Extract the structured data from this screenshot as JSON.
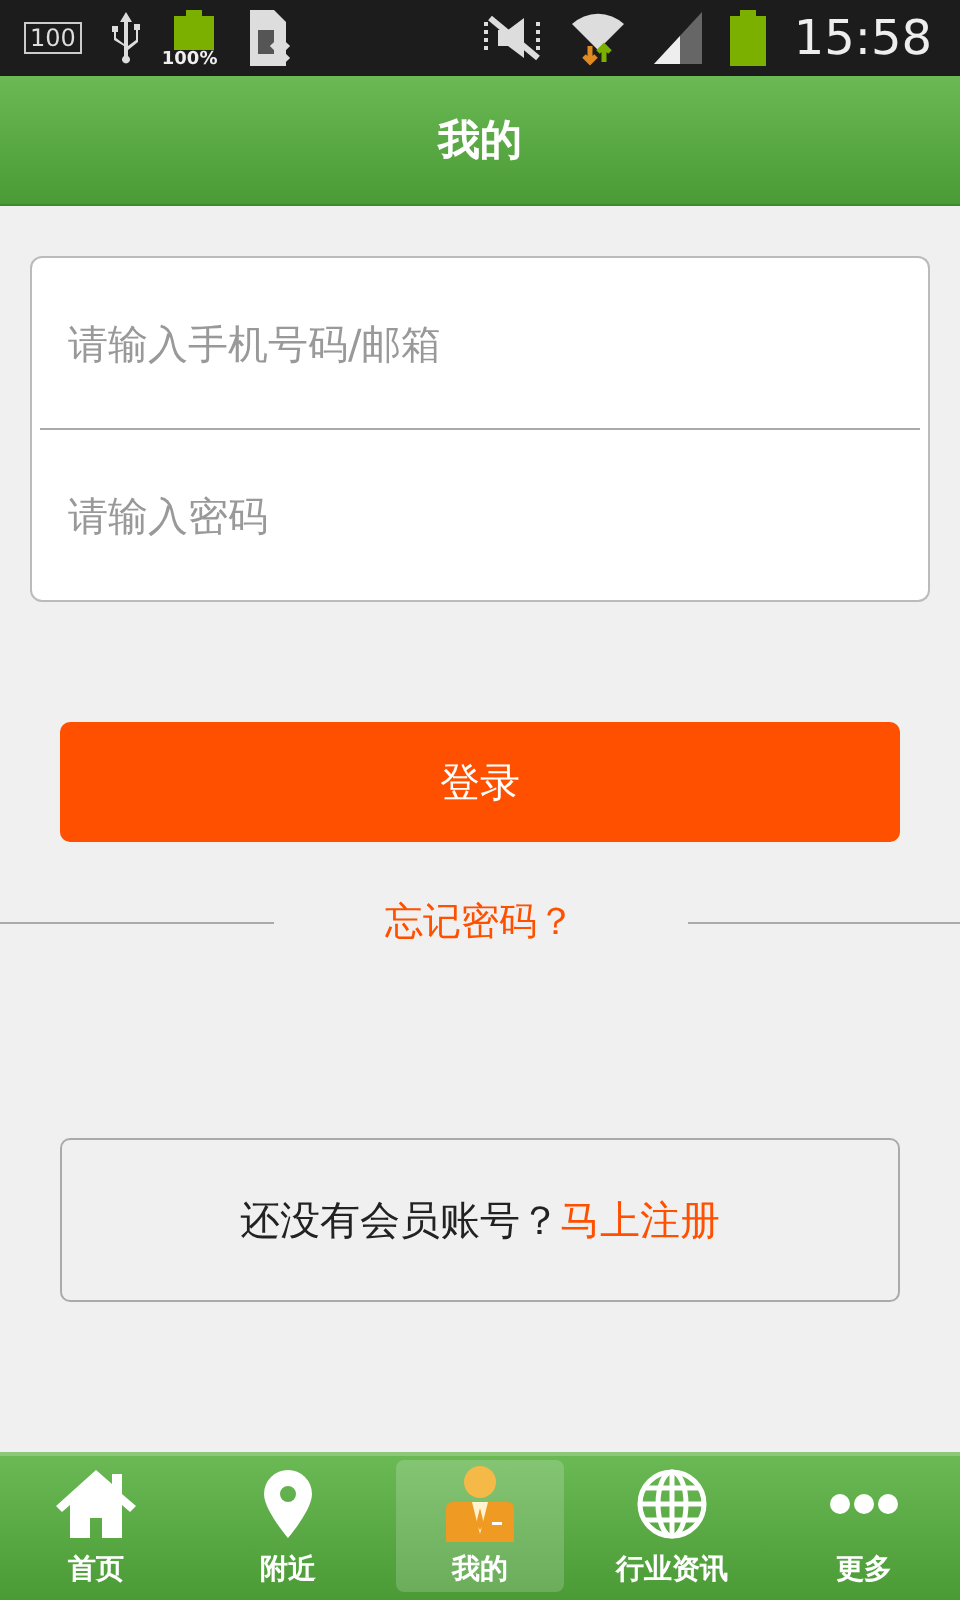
{
  "status_bar": {
    "storage_label": "100",
    "battery_label": "100%",
    "time": "15:58"
  },
  "header": {
    "title": "我的"
  },
  "login_form": {
    "fields": [
      {
        "placeholder": "请输入手机号码/邮箱"
      },
      {
        "placeholder": "请输入密码"
      }
    ],
    "login_button": "登录",
    "forgot_password": "忘记密码？"
  },
  "register": {
    "prompt": "还没有会员账号？",
    "link": "马上注册"
  },
  "tab_bar": [
    {
      "label": "首页",
      "selected": false
    },
    {
      "label": "附近",
      "selected": false
    },
    {
      "label": "我的",
      "selected": true
    },
    {
      "label": "行业资讯",
      "selected": false
    },
    {
      "label": "更多",
      "selected": false
    }
  ]
}
